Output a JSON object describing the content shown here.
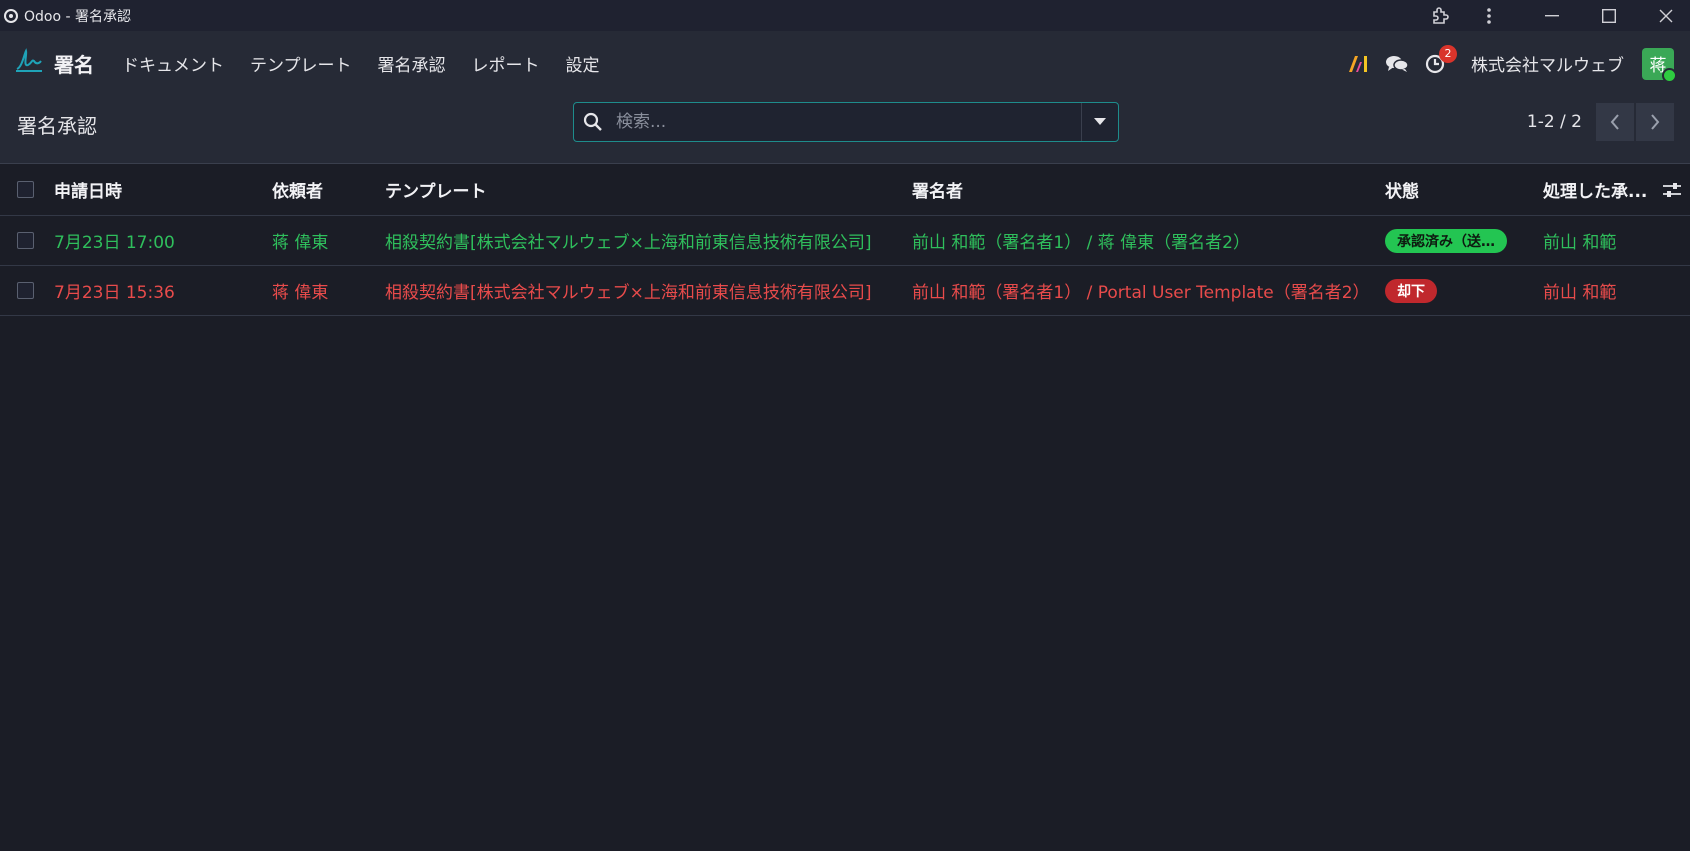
{
  "window": {
    "title": "Odoo - 署名承認"
  },
  "nav": {
    "brand": "署名",
    "menu": [
      "ドキュメント",
      "テンプレート",
      "署名承認",
      "レポート",
      "設定"
    ],
    "activity_count": "2",
    "company": "株式会社マルウェブ",
    "avatar_letter": "蒋"
  },
  "control": {
    "page_title": "署名承認",
    "search_placeholder": "検索...",
    "search_value": "",
    "pager": "1-2 / 2"
  },
  "table": {
    "columns": [
      "申請日時",
      "依頼者",
      "テンプレート",
      "署名者",
      "状態",
      "処理した承..."
    ],
    "rows": [
      {
        "date": "7月23日 17:00",
        "requester": "蒋 偉東",
        "template": "相殺契約書[株式会社マルウェブ×上海和前東信息技術有限公司]",
        "signers": "前山 和範（署名者1） / 蒋 偉東（署名者2）",
        "status": "承認済み（送信...",
        "approver": "前山 和範",
        "color": "#2fbf5c"
      },
      {
        "date": "7月23日 15:36",
        "requester": "蒋 偉東",
        "template": "相殺契約書[株式会社マルウェブ×上海和前東信息技術有限公司]",
        "signers": "前山 和範（署名者1） / Portal User Template（署名者2）",
        "status": "却下",
        "approver": "前山 和範",
        "color": "#e84b4b"
      }
    ]
  },
  "colors": {
    "approved": "#23c552",
    "rejected": "#c0282d",
    "accent": "#1e8c8c"
  }
}
